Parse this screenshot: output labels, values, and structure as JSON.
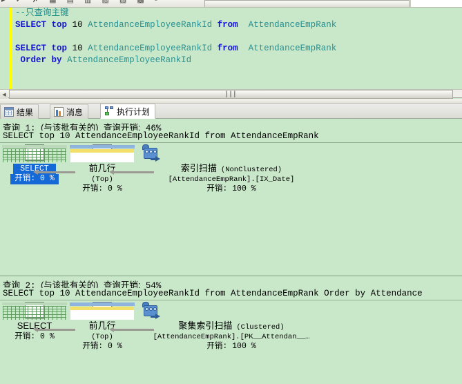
{
  "toolbar": {
    "glyphs": "▸ ✓ ✗ ▦ ▤ ▥ ▧ ▨ ▩ ▫",
    "combo_text": "· · · · · · · · · · · ·"
  },
  "editor": {
    "lines": [
      {
        "segments": [
          {
            "text": "--只查询主键",
            "cls": "cl-comment"
          }
        ]
      },
      {
        "segments": [
          {
            "text": "SELECT",
            "cls": "cl-kw"
          },
          {
            "text": " ",
            "cls": "cl-plain"
          },
          {
            "text": "top",
            "cls": "cl-kw"
          },
          {
            "text": " ",
            "cls": "cl-plain"
          },
          {
            "text": "10",
            "cls": "cl-num"
          },
          {
            "text": " ",
            "cls": "cl-plain"
          },
          {
            "text": "AttendanceEmployeeRankId",
            "cls": "cl-id"
          },
          {
            "text": " ",
            "cls": "cl-plain"
          },
          {
            "text": "from",
            "cls": "cl-kw"
          },
          {
            "text": "  ",
            "cls": "cl-plain"
          },
          {
            "text": "AttendanceEmpRank",
            "cls": "cl-id"
          }
        ]
      },
      {
        "segments": []
      },
      {
        "segments": [
          {
            "text": "SELECT",
            "cls": "cl-kw"
          },
          {
            "text": " ",
            "cls": "cl-plain"
          },
          {
            "text": "top",
            "cls": "cl-kw"
          },
          {
            "text": " ",
            "cls": "cl-plain"
          },
          {
            "text": "10",
            "cls": "cl-num"
          },
          {
            "text": " ",
            "cls": "cl-plain"
          },
          {
            "text": "AttendanceEmployeeRankId",
            "cls": "cl-id"
          },
          {
            "text": " ",
            "cls": "cl-plain"
          },
          {
            "text": "from",
            "cls": "cl-kw"
          },
          {
            "text": "  ",
            "cls": "cl-plain"
          },
          {
            "text": "AttendanceEmpRank",
            "cls": "cl-id"
          }
        ]
      },
      {
        "segments": [
          {
            "text": " ",
            "cls": "cl-plain"
          },
          {
            "text": "Order",
            "cls": "cl-kw"
          },
          {
            "text": " ",
            "cls": "cl-plain"
          },
          {
            "text": "by",
            "cls": "cl-kw"
          },
          {
            "text": " ",
            "cls": "cl-plain"
          },
          {
            "text": "AttendanceEmployeeRankId",
            "cls": "cl-id"
          }
        ]
      }
    ]
  },
  "tabs": [
    {
      "label": "结果",
      "icon": "results-grid-icon",
      "active": false
    },
    {
      "label": "消息",
      "icon": "messages-icon",
      "active": false
    },
    {
      "label": "执行计划",
      "icon": "execution-plan-icon",
      "active": true
    }
  ],
  "plans": [
    {
      "header_prefix": "查询",
      "header_number": "1:",
      "header_relative": "(与该批有关的)",
      "header_cost_label": "查询开销:",
      "header_cost_value": "46%",
      "sql": "SELECT top 10 AttendanceEmployeeRankId from AttendanceEmpRank",
      "nodes": [
        {
          "icon": "select-result-icon",
          "title": "SELECT",
          "subtitle": "",
          "detail": "",
          "cost": "开销: 0 %",
          "selected": true
        },
        {
          "icon": "top-operator-icon",
          "title": "前几行",
          "subtitle": "(Top)",
          "detail": "",
          "cost": "开销: 0 %",
          "selected": false
        },
        {
          "icon": "index-scan-icon",
          "title": "索引扫描",
          "subtitle": "(NonClustered)",
          "detail": "[AttendanceEmpRank].[IX_Date]",
          "cost": "开销: 100 %",
          "selected": false
        }
      ]
    },
    {
      "header_prefix": "查询",
      "header_number": "2:",
      "header_relative": "(与该批有关的)",
      "header_cost_label": "查询开销:",
      "header_cost_value": "54%",
      "sql": "SELECT top 10 AttendanceEmployeeRankId from AttendanceEmpRank Order by Attendance",
      "nodes": [
        {
          "icon": "select-result-icon",
          "title": "SELECT",
          "subtitle": "",
          "detail": "",
          "cost": "开销: 0 %",
          "selected": false
        },
        {
          "icon": "top-operator-icon",
          "title": "前几行",
          "subtitle": "(Top)",
          "detail": "",
          "cost": "开销: 0 %",
          "selected": false
        },
        {
          "icon": "clustered-index-scan-icon",
          "title": "聚集索引扫描",
          "subtitle": "(Clustered)",
          "detail": "[AttendanceEmpRank].[PK__Attendan__…",
          "cost": "开销: 100 %",
          "selected": false
        }
      ]
    }
  ],
  "scrollbar": {
    "grip": "┃┃┃",
    "left_arrow": "◀"
  },
  "colors": {
    "plan_background": "#c9e7c9",
    "selection": "#1569d6",
    "keyword": "#1414d8",
    "identifier": "#2a9090",
    "comment": "#1b8a8a"
  }
}
